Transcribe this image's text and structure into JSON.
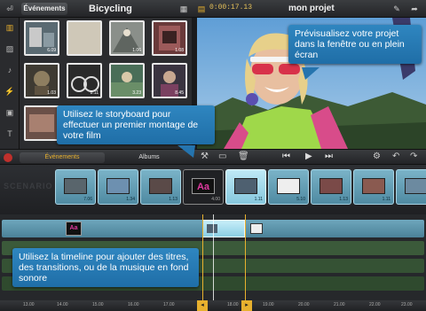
{
  "topbar": {
    "events_tab": "Événements",
    "library_title": "Bicycling",
    "timecode": "0:00:17.13",
    "project_title": "mon projet"
  },
  "library": {
    "thumbs": [
      {
        "duration": "6.09",
        "color": "#5a6a72"
      },
      {
        "duration": "",
        "color": "#cfc8b8"
      },
      {
        "duration": "1.06",
        "color": "#8a8f8a"
      },
      {
        "duration": "1.08",
        "color": "#6a3a3a"
      },
      {
        "duration": "1.03",
        "color": "#3e3a32"
      },
      {
        "duration": "8.11",
        "color": "#2a2a2a"
      },
      {
        "duration": "3.23",
        "color": "#4a6e58"
      },
      {
        "duration": "8.45",
        "color": "#3a3440"
      },
      {
        "duration": "",
        "color": "#6a5048"
      }
    ]
  },
  "midbar": {
    "events_label": "Événements",
    "albums_label": "Albums"
  },
  "storyboard": {
    "label": "SCENARIO",
    "clips": [
      {
        "duration": "7.06",
        "title": false
      },
      {
        "duration": "1.34",
        "title": false
      },
      {
        "duration": "1.13",
        "title": false
      },
      {
        "duration": "4.00",
        "title": true,
        "title_text": "Aa"
      },
      {
        "duration": "1.11",
        "title": false,
        "active": true
      },
      {
        "duration": "5.10",
        "title": false
      },
      {
        "duration": "1.13",
        "title": false
      },
      {
        "duration": "1.11",
        "title": false
      },
      {
        "duration": "",
        "title": false
      }
    ]
  },
  "timeline": {
    "title_clip_text": "Aa",
    "ruler_ticks": [
      "13.00",
      "14.00",
      "15.00",
      "16.00",
      "17.00",
      "18.00",
      "19.00",
      "20.00",
      "21.00",
      "22.00",
      "23.00"
    ]
  },
  "callouts": {
    "preview": "Prévisualisez votre projet dans la fenêtre ou en plein écran",
    "storyboard": "Utilisez le storyboard pour effectuer un premier montage de votre film",
    "timeline": "Utilisez la timeline pour ajouter des titres, des transitions, ou de la musique en fond sonore"
  },
  "colors": {
    "accent": "#e8b12e",
    "callout": "#2a7fba",
    "clip": "#6aa9c0"
  }
}
